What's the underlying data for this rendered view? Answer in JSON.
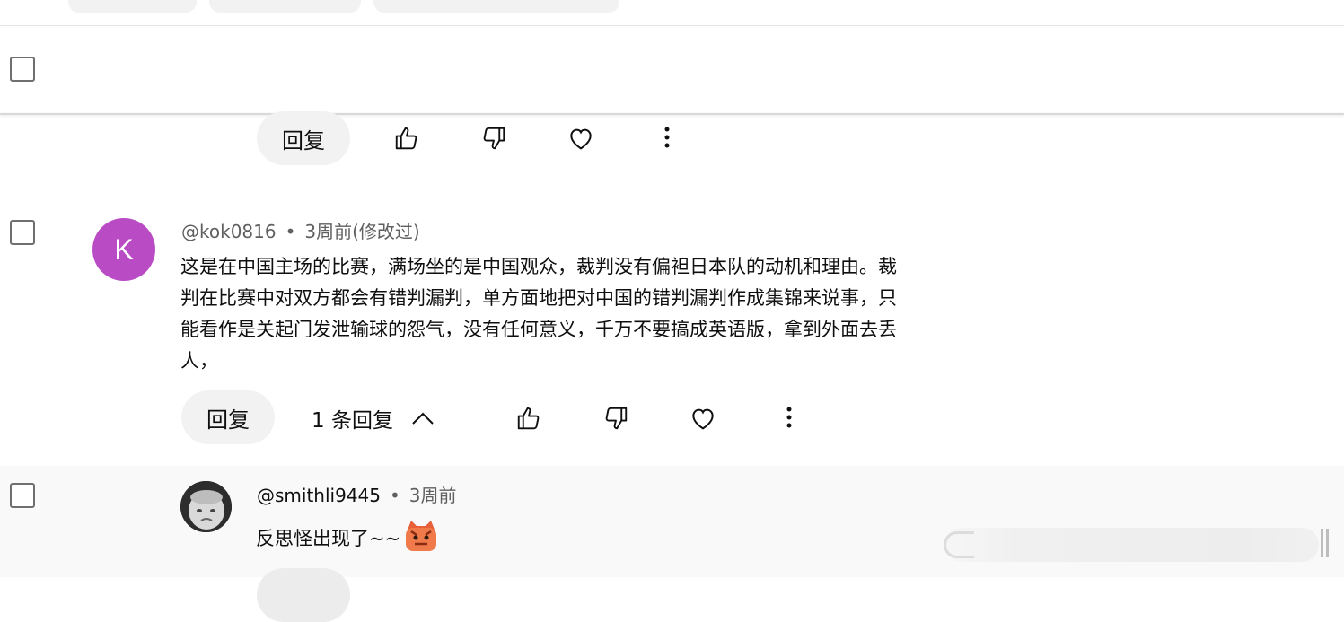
{
  "actions": {
    "reply_label": "回复",
    "replies_toggle_label": "1 条回复"
  },
  "comments": [
    {
      "author": "@kok0816",
      "time": "3周前",
      "edited": "(修改过)",
      "avatar_letter": "K",
      "avatar_color": "#b94cc5",
      "text_lines": [
        "这是在中国主场的比赛，满场坐的是中国观众，裁判没有偏袒日本队的动机和理由。裁",
        "判在比赛中对双方都会有错判漏判，单方面地把对中国的错判漏判作成集锦来说事，只",
        "能看作是关起门发泄输球的怨气，没有任何意义，千万不要搞成英语版，拿到外面去丢",
        "人，"
      ]
    },
    {
      "author": "@smithli9445",
      "time": "3周前",
      "text": "反思怪出现了~~",
      "avatar_icon": "baby-face-avatar",
      "emoji_icon": "tiger-emoji-icon"
    }
  ],
  "icons": {
    "like": "thumbs-up-icon",
    "dislike": "thumbs-down-icon",
    "heart": "heart-icon",
    "more": "more-vert-icon",
    "chevron": "chevron-up-icon"
  }
}
